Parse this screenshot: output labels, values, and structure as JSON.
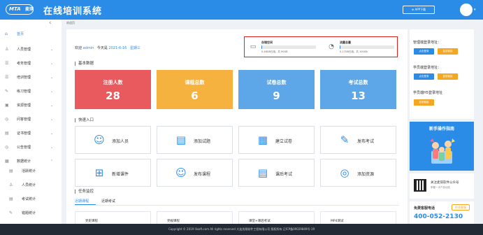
{
  "header": {
    "logo_text": "MTA",
    "logo_cn": "麦琪",
    "title": "在线培训系统",
    "app_download": "⊕ APP下载"
  },
  "sidebar": {
    "items": [
      {
        "label": "首页",
        "icon": "home-icon",
        "glyph": "⌂"
      },
      {
        "label": "人员管理",
        "icon": "user-icon",
        "glyph": "♙"
      },
      {
        "label": "考务管理",
        "icon": "exam-icon",
        "glyph": "☰"
      },
      {
        "label": "培训管理",
        "icon": "training-icon",
        "glyph": "☰"
      },
      {
        "label": "练习管理",
        "icon": "practice-icon",
        "glyph": "✎"
      },
      {
        "label": "资源管理",
        "icon": "resource-icon",
        "glyph": "▣"
      },
      {
        "label": "问答管理",
        "icon": "qa-icon",
        "glyph": "◎"
      },
      {
        "label": "证书管理",
        "icon": "certificate-icon",
        "glyph": "▤"
      },
      {
        "label": "公告管理",
        "icon": "notice-icon",
        "glyph": "◎"
      },
      {
        "label": "数据统计",
        "icon": "stats-icon",
        "glyph": "▦"
      }
    ],
    "subitems": [
      {
        "label": "活跃统计",
        "icon": "activity-icon",
        "glyph": "▤"
      },
      {
        "label": "人员统计",
        "icon": "person-stats-icon",
        "glyph": "♙"
      },
      {
        "label": "考试统计",
        "icon": "exam-stats-icon",
        "glyph": "▤"
      },
      {
        "label": "错题统计",
        "icon": "wrong-stats-icon",
        "glyph": "✎"
      }
    ]
  },
  "breadcrumb": "欢迎页",
  "welcome": {
    "prefix": "欢迎",
    "user": "admin",
    "today_label": "今天是",
    "date": "2021-6-16",
    "weekday": "星期三"
  },
  "storage": [
    {
      "title": "存储空间",
      "desc": "0.48GB已用，共 90GB",
      "used_fraction": 0.005
    },
    {
      "title": "流量总量",
      "desc": "0.17GB已用，共 100GB",
      "used_fraction": 0.002
    }
  ],
  "basic_data": {
    "title": "基本数据",
    "stats": [
      {
        "label": "注册人数",
        "value": "28",
        "color": "#e85a5e"
      },
      {
        "label": "课程总数",
        "value": "6",
        "color": "#f6b23f"
      },
      {
        "label": "试卷总数",
        "value": "9",
        "color": "#5da6e8"
      },
      {
        "label": "考试总数",
        "value": "13",
        "color": "#5da6e8"
      }
    ]
  },
  "quick_entry": {
    "title": "快速入口",
    "items": [
      {
        "label": "添加人员",
        "icon": "add-user-icon",
        "glyph": "☺"
      },
      {
        "label": "添加试题",
        "icon": "add-question-icon",
        "glyph": "▤"
      },
      {
        "label": "建立试卷",
        "icon": "create-paper-icon",
        "glyph": "▦"
      },
      {
        "label": "发布考试",
        "icon": "publish-exam-icon",
        "glyph": "✎"
      },
      {
        "label": "新增课件",
        "icon": "add-courseware-icon",
        "glyph": "⊞"
      },
      {
        "label": "发布课程",
        "icon": "publish-course-icon",
        "glyph": "☺"
      },
      {
        "label": "课后考试",
        "icon": "after-class-exam-icon",
        "glyph": "▤"
      },
      {
        "label": "添加资源",
        "icon": "add-resource-icon",
        "glyph": "◎"
      }
    ]
  },
  "task_monitor": {
    "title": "任务监控",
    "tabs": [
      "近期课程",
      "近期考试"
    ],
    "cards": [
      "党史课程",
      "党规课程",
      "课堂+课后考试",
      "MP4测试"
    ]
  },
  "right_panel": {
    "manage_login": "管理端登录地址：",
    "student_login": "学员端登录地址：",
    "student_h5_login": "学员端H5登录地址",
    "btn_login": "点击登录",
    "btn_copy": "复制链接",
    "guide_title": "新手操作指南",
    "wechat_line1": "关注麦琪软件公众号",
    "wechat_line2": "掌握一手产品动态",
    "hotline_title": "免费客服电话",
    "hotline_badge": "在线客服",
    "hotline_number": "400-052-2130"
  },
  "footer": "Copyright © 2019 llisoft.com All rights reserved 大连炫翔软件工程有限公司 版权所有 辽ICP备09029849号-19",
  "colors": {
    "primary": "#2b8ce8",
    "highlight": "#e0201b",
    "orange": "#f5a623"
  }
}
